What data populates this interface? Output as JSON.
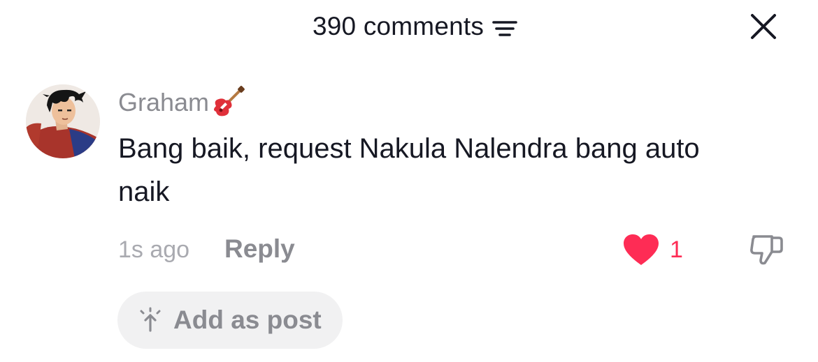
{
  "header": {
    "title": "390 comments",
    "sort_icon": "sort-lines-icon",
    "close_icon": "close-icon"
  },
  "comment": {
    "username": "Graham",
    "username_emoji": "guitar-icon",
    "text": "Bang baik, request Nakula Nalendra bang auto naik",
    "time": "1s ago",
    "reply_label": "Reply",
    "like_count": "1",
    "liked": true,
    "add_post_label": "Add as post"
  },
  "colors": {
    "like_accent": "#fe2c55",
    "primary_text": "#161823",
    "secondary_text": "#8a8b91",
    "chip_background": "#f1f1f2"
  }
}
